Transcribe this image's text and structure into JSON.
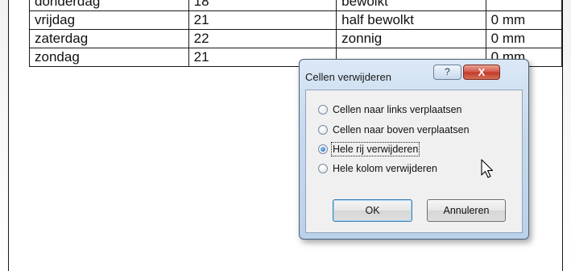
{
  "table": {
    "rows": [
      [
        "donderdag",
        "18",
        "bewolkt",
        ""
      ],
      [
        "vrijdag",
        "21",
        "half bewolkt",
        "0 mm"
      ],
      [
        "zaterdag",
        "22",
        "zonnig",
        "0 mm"
      ],
      [
        "zondag",
        "21",
        "",
        "0 mm"
      ]
    ]
  },
  "dialog": {
    "title": "Cellen verwijderen",
    "help_label": "?",
    "close_label": "X",
    "options": [
      {
        "label": "Cellen naar links verplaatsen",
        "checked": false
      },
      {
        "label": "Cellen naar boven verplaatsen",
        "checked": false
      },
      {
        "label": "Hele rij verwijderen",
        "checked": true
      },
      {
        "label": "Hele kolom verwijderen",
        "checked": false
      }
    ],
    "ok_label": "OK",
    "cancel_label": "Annuleren"
  },
  "icons": {
    "cursor": "mouse-pointer-icon"
  }
}
